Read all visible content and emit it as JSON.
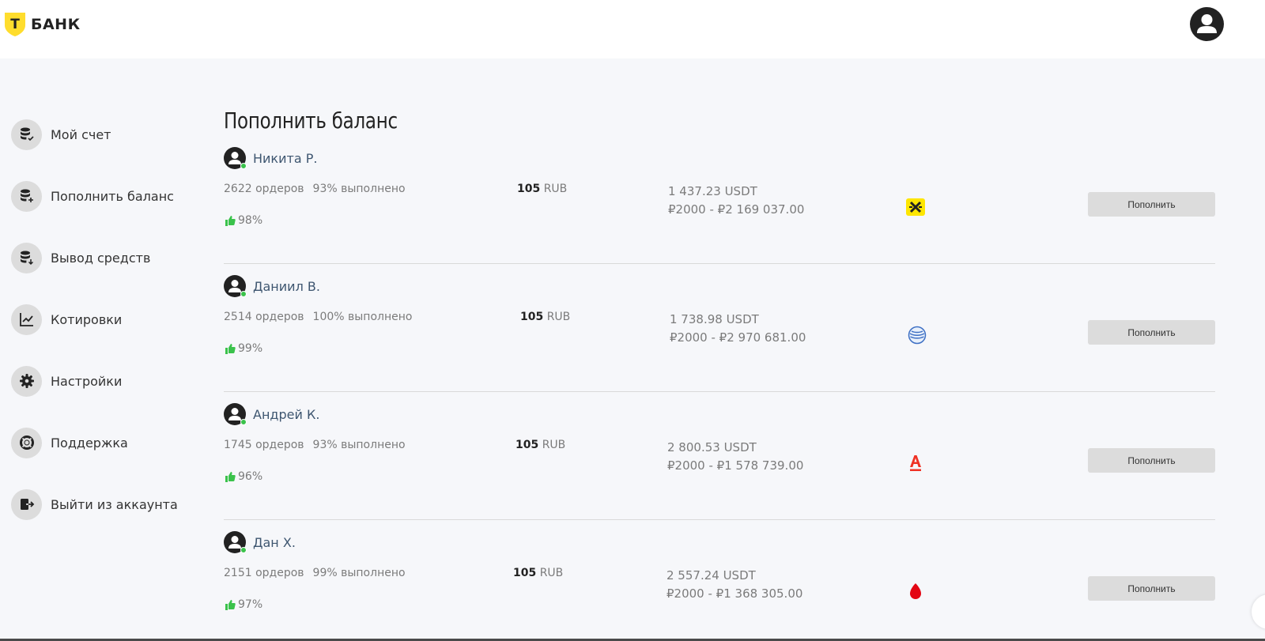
{
  "brand": {
    "name": "БАНК",
    "letter": "Т",
    "color": "#ffdd2d"
  },
  "colors": {
    "accent_name": "#3e5670",
    "online": "#3ac24b",
    "like": "#3ac24b",
    "button_bg": "#dcdcdc"
  },
  "sidebar": {
    "items": [
      {
        "label": "Мой счет",
        "icon": "coins-check-icon"
      },
      {
        "label": "Пополнить баланс",
        "icon": "coins-plus-icon"
      },
      {
        "label": "Вывод средств",
        "icon": "coins-minus-icon"
      },
      {
        "label": "Котировки",
        "icon": "chart-line-icon"
      },
      {
        "label": "Настройки",
        "icon": "gear-icon"
      },
      {
        "label": "Поддержка",
        "icon": "lifebuoy-icon"
      },
      {
        "label": "Выйти из аккаунта",
        "icon": "logout-icon"
      }
    ]
  },
  "page": {
    "title": "Пополнить баланс"
  },
  "offers": [
    {
      "name": "Никита Р.",
      "orders": "2622 ордеров",
      "completion": "93% выполнено",
      "rating": "98%",
      "price": "105",
      "currency": "RUB",
      "available": "1 437.23 USDT",
      "limits": "₽2000 - ₽2 169 037.00",
      "bank": "raiffeisen-icon",
      "button": "Пополнить"
    },
    {
      "name": "Даниил В.",
      "orders": "2514 ордеров",
      "completion": "100% выполнено",
      "rating": "99%",
      "price": "105",
      "currency": "RUB",
      "available": "1 738.98 USDT",
      "limits": "₽2000 - ₽2 970 681.00",
      "bank": "gazprombank-icon",
      "button": "Пополнить"
    },
    {
      "name": "Андрей К.",
      "orders": "1745 ордеров",
      "completion": "93% выполнено",
      "rating": "96%",
      "price": "105",
      "currency": "RUB",
      "available": "2 800.53 USDT",
      "limits": "₽2000 - ₽1 578 739.00",
      "bank": "alfabank-icon",
      "button": "Пополнить"
    },
    {
      "name": "Дан Х.",
      "orders": "2151 ордеров",
      "completion": "99% выполнено",
      "rating": "97%",
      "price": "105",
      "currency": "RUB",
      "available": "2 557.24 USDT",
      "limits": "₽2000 - ₽1 368 305.00",
      "bank": "drop-bank-icon",
      "button": "Пополнить"
    }
  ]
}
